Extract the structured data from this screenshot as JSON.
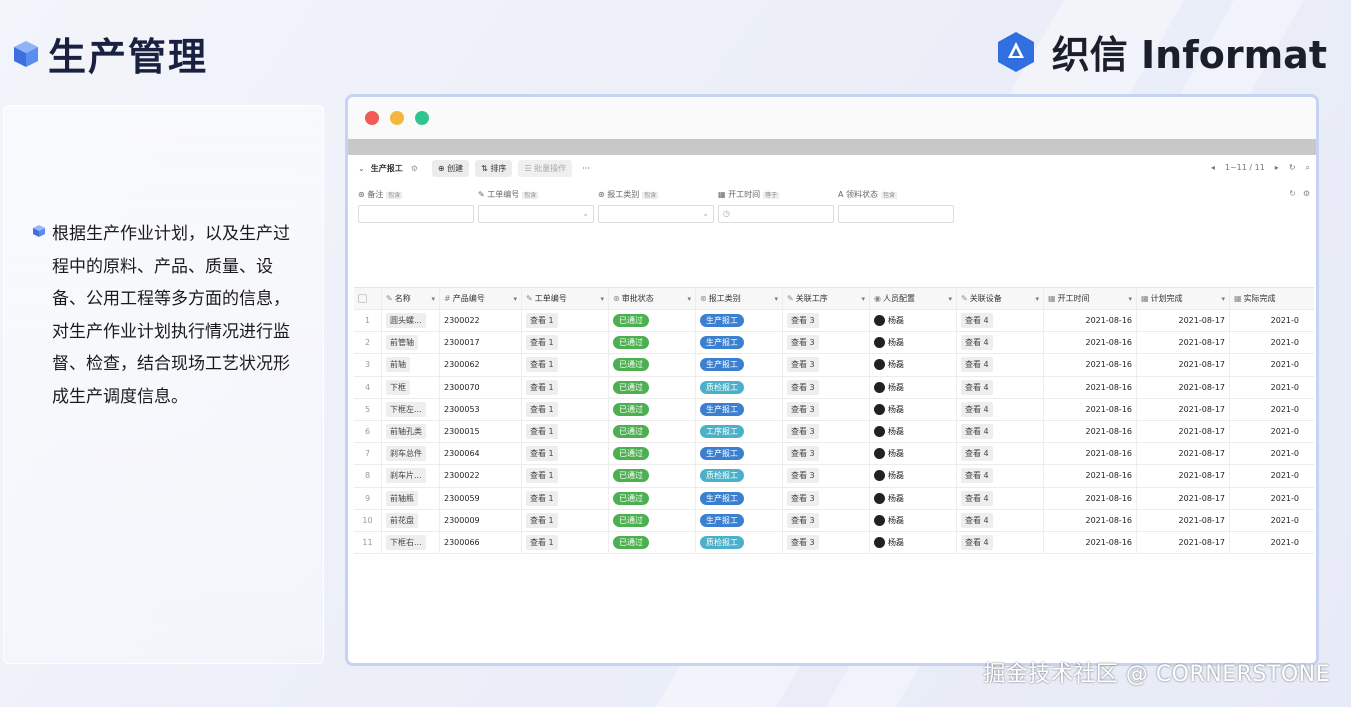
{
  "page": {
    "title": "生产管理"
  },
  "brand": {
    "name": "织信 Informat",
    "color": "#2f6fe0"
  },
  "description": {
    "text": "根据生产作业计划，以及生产过程中的原料、产品、质量、设备、公用工程等多方面的信息，对生产作业计划执行情况进行监督、检查，结合现场工艺状况形成生产调度信息。"
  },
  "window": {
    "dots": [
      "#f05a57",
      "#f4b63f",
      "#31c48d"
    ]
  },
  "toolbar": {
    "view_name": "生产报工",
    "create_label": "创建",
    "sort_label": "排序",
    "batch_label": "批量操作",
    "more_label": "···",
    "pager": "1~11 / 11"
  },
  "filters": [
    {
      "label": "备注",
      "tag": "包含"
    },
    {
      "label": "工单编号",
      "tag": "包含"
    },
    {
      "label": "报工类别",
      "tag": "包含"
    },
    {
      "label": "开工时间",
      "tag": "等于"
    },
    {
      "label": "领料状态",
      "tag": "包含"
    }
  ],
  "table": {
    "columns": [
      "名称",
      "产品编号",
      "工单编号",
      "审批状态",
      "报工类别",
      "关联工序",
      "人员配置",
      "关联设备",
      "开工时间",
      "计划完成",
      "实际完成"
    ],
    "rows": [
      {
        "no": "1",
        "name": "圆头螺...",
        "product": "2300022",
        "order": "查看 1",
        "status": "已通过",
        "type": "生产报工",
        "proc": "查看 3",
        "person": "杨磊",
        "device": "查看 4",
        "start": "2021-08-16",
        "plan": "2021-08-17",
        "actual": "2021-0"
      },
      {
        "no": "2",
        "name": "前管轴",
        "product": "2300017",
        "order": "查看 1",
        "status": "已通过",
        "type": "生产报工",
        "proc": "查看 3",
        "person": "杨磊",
        "device": "查看 4",
        "start": "2021-08-16",
        "plan": "2021-08-17",
        "actual": "2021-0"
      },
      {
        "no": "3",
        "name": "前轴",
        "product": "2300062",
        "order": "查看 1",
        "status": "已通过",
        "type": "生产报工",
        "proc": "查看 3",
        "person": "杨磊",
        "device": "查看 4",
        "start": "2021-08-16",
        "plan": "2021-08-17",
        "actual": "2021-0"
      },
      {
        "no": "4",
        "name": "下框",
        "product": "2300070",
        "order": "查看 1",
        "status": "已通过",
        "type": "质检报工",
        "proc": "查看 3",
        "person": "杨磊",
        "device": "查看 4",
        "start": "2021-08-16",
        "plan": "2021-08-17",
        "actual": "2021-0"
      },
      {
        "no": "5",
        "name": "下框左...",
        "product": "2300053",
        "order": "查看 1",
        "status": "已通过",
        "type": "生产报工",
        "proc": "查看 3",
        "person": "杨磊",
        "device": "查看 4",
        "start": "2021-08-16",
        "plan": "2021-08-17",
        "actual": "2021-0"
      },
      {
        "no": "6",
        "name": "前轴孔类",
        "product": "2300015",
        "order": "查看 1",
        "status": "已通过",
        "type": "工序报工",
        "proc": "查看 3",
        "person": "杨磊",
        "device": "查看 4",
        "start": "2021-08-16",
        "plan": "2021-08-17",
        "actual": "2021-0"
      },
      {
        "no": "7",
        "name": "刹车总件",
        "product": "2300064",
        "order": "查看 1",
        "status": "已通过",
        "type": "生产报工",
        "proc": "查看 3",
        "person": "杨磊",
        "device": "查看 4",
        "start": "2021-08-16",
        "plan": "2021-08-17",
        "actual": "2021-0"
      },
      {
        "no": "8",
        "name": "刹车片...",
        "product": "2300022",
        "order": "查看 1",
        "status": "已通过",
        "type": "质检报工",
        "proc": "查看 3",
        "person": "杨磊",
        "device": "查看 4",
        "start": "2021-08-16",
        "plan": "2021-08-17",
        "actual": "2021-0"
      },
      {
        "no": "9",
        "name": "前轴瓶",
        "product": "2300059",
        "order": "查看 1",
        "status": "已通过",
        "type": "生产报工",
        "proc": "查看 3",
        "person": "杨磊",
        "device": "查看 4",
        "start": "2021-08-16",
        "plan": "2021-08-17",
        "actual": "2021-0"
      },
      {
        "no": "10",
        "name": "前花盘",
        "product": "2300009",
        "order": "查看 1",
        "status": "已通过",
        "type": "生产报工",
        "proc": "查看 3",
        "person": "杨磊",
        "device": "查看 4",
        "start": "2021-08-16",
        "plan": "2021-08-17",
        "actual": "2021-0"
      },
      {
        "no": "11",
        "name": "下框右...",
        "product": "2300066",
        "order": "查看 1",
        "status": "已通过",
        "type": "质检报工",
        "proc": "查看 3",
        "person": "杨磊",
        "device": "查看 4",
        "start": "2021-08-16",
        "plan": "2021-08-17",
        "actual": "2021-0"
      }
    ]
  },
  "type_colors": {
    "生产报工": "#3a7fd0",
    "质检报工": "#4cb1c8",
    "工序报工": "#4cb1c8"
  },
  "watermark": "掘金技术社区 @ CORNERSTONE"
}
